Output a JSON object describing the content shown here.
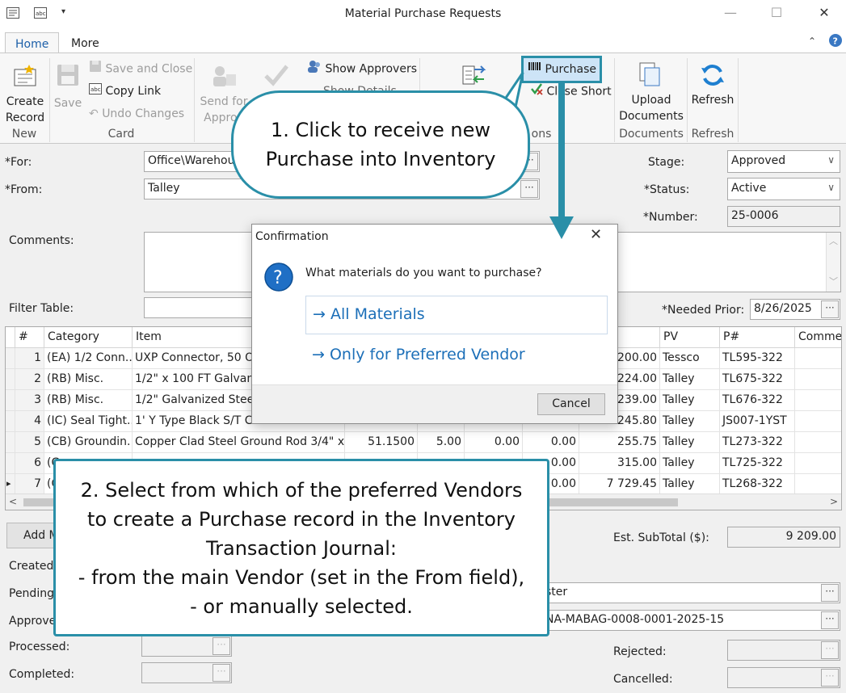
{
  "window": {
    "title": "Material Purchase Requests",
    "minimize": "—",
    "maximize": "☐",
    "close": "✕"
  },
  "tabs": [
    {
      "label": "Home"
    },
    {
      "label": "More"
    }
  ],
  "ribbon": {
    "new": {
      "create_record": "Create\nRecord",
      "group": "New"
    },
    "card": {
      "save": "Save",
      "save_and_close": "Save and Close",
      "copy_link": "Copy Link",
      "undo_changes": "Undo Changes",
      "group": "Card"
    },
    "approvals": {
      "send_for": "Send for",
      "approv": "Approv",
      "show_approvers": "Show Approvers",
      "show_details": "Show Details"
    },
    "actions": {
      "purchase": "Purchase",
      "close_short": "Close Short",
      "group_tail": "ons"
    },
    "documents": {
      "upload": "Upload\nDocuments",
      "group": "Documents"
    },
    "refresh": {
      "label": "Refresh",
      "group": "Refresh"
    }
  },
  "form": {
    "for_label": "*For:",
    "for_value": "Office\\Warehou",
    "from_label": "*From:",
    "from_value": "Talley",
    "stage_label": "Stage:",
    "stage_value": "Approved",
    "status_label": "*Status:",
    "status_value": "Active",
    "number_label": "*Number:",
    "number_value": "25-0006",
    "comments_label": "Comments:",
    "filter_label": "Filter Table:",
    "needed_prior_label": "*Needed Prior:",
    "needed_prior_value": "8/26/2025",
    "add_button": "Add M",
    "est_subtotal_label": "Est. SubTotal ($):",
    "est_subtotal_value": "9 209.00",
    "created_label": "Created",
    "pending_label": "Pending",
    "pending_value": "ster",
    "approved_label": "Approve",
    "approved_value": "NA-MABAG-0008-0001-2025-15",
    "processed_label": "Processed:",
    "completed_label": "Completed:",
    "rejected_label": "Rejected:",
    "cancelled_label": "Cancelled:"
  },
  "grid": {
    "headers": {
      "num": "#",
      "category": "Category",
      "item": "Item",
      "total": "tal ($)",
      "pv": "PV",
      "pn": "P#",
      "comment": "Commen"
    },
    "rows": [
      {
        "n": "1",
        "category": "(EA) 1/2 Conn...",
        "item": "UXP Connector, 50 Oh",
        "total": "200.00",
        "pv": "Tessco",
        "pn": "TL595-322"
      },
      {
        "n": "2",
        "category": "(RB) Misc.",
        "item": "1/2\" x 100 FT Galvaniz",
        "total": "224.00",
        "pv": "Talley",
        "pn": "TL675-322"
      },
      {
        "n": "3",
        "category": "(RB) Misc.",
        "item": "1/2\" Galvanized Steel",
        "total": "239.00",
        "pv": "Talley",
        "pn": "TL676-322"
      },
      {
        "n": "4",
        "category": "(IC) Seal Tight...",
        "item": "1' Y Type Black S/T Co",
        "total": "245.80",
        "pv": "Talley",
        "pn": "JS007-1YST"
      },
      {
        "n": "5",
        "category": "(CB) Groundin...",
        "item": "Copper Clad Steel Ground Rod 3/4\" x...",
        "price": "51.1500",
        "qty": "5.00",
        "c1": "0.00",
        "c2": "0.00",
        "total": "255.75",
        "pv": "Talley",
        "pn": "TL273-322"
      },
      {
        "n": "6",
        "category": "(C",
        "c2": "0.00",
        "total": "315.00",
        "pv": "Talley",
        "pn": "TL725-322"
      },
      {
        "n": "7",
        "category": "(C",
        "c2": "0.00",
        "total": "7 729.45",
        "pv": "Talley",
        "pn": "TL268-322"
      }
    ]
  },
  "dialog": {
    "title": "Confirmation",
    "question": "What materials do you want to purchase?",
    "option_all": "All Materials",
    "option_preferred": "Only for Preferred Vendor",
    "cancel": "Cancel"
  },
  "callout1": {
    "line1": "1. Click to receive new",
    "line2": "Purchase into Inventory"
  },
  "callout2": {
    "line1": "2. Select from which of the preferred Vendors",
    "line2": "to create a Purchase record in the Inventory",
    "line3": "Transaction Journal:",
    "line4": "- from the main Vendor (set in the From field),",
    "line5": "- or manually selected."
  },
  "colors": {
    "accent": "#2a8fa8",
    "link": "#1c6fb8",
    "purchase_bg": "#cde4f7"
  }
}
